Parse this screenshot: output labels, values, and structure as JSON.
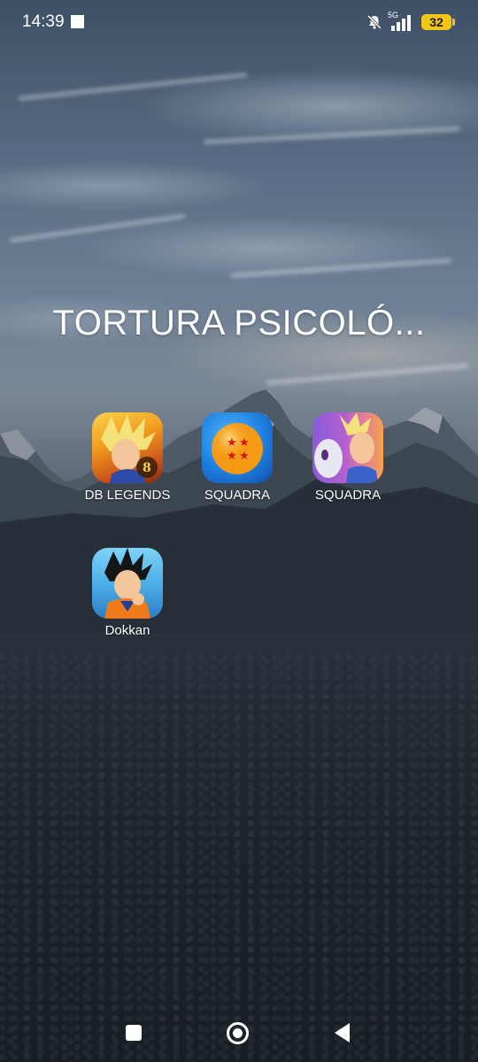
{
  "status_bar": {
    "time": "14:39",
    "network": "5G",
    "battery": "32",
    "icons": [
      "notification-square-icon",
      "mute-icon",
      "signal-icon",
      "battery-icon"
    ]
  },
  "folder": {
    "title": "TORTURA PSICOLÓ...",
    "apps": [
      {
        "label": "DB LEGENDS",
        "icon": "db-legends-app-icon"
      },
      {
        "label": "SQUADRA",
        "icon": "dragon-ball-app-icon"
      },
      {
        "label": "SQUADRA",
        "icon": "squadra-characters-app-icon"
      },
      {
        "label": "Dokkan",
        "icon": "dokkan-app-icon"
      }
    ]
  },
  "nav_bar": {
    "buttons": [
      "recent-apps",
      "home",
      "back"
    ]
  },
  "colors": {
    "battery": "#f3c515",
    "text": "#ffffff"
  }
}
